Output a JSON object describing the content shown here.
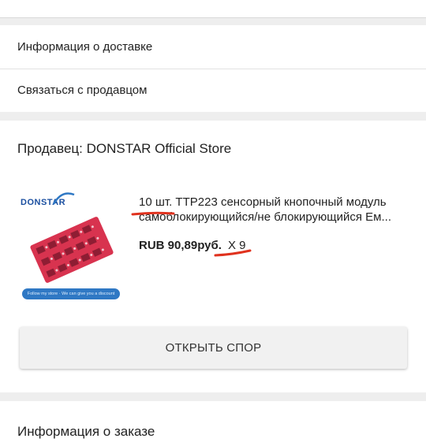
{
  "links": {
    "delivery_info": "Информация о доставке",
    "contact_seller": "Связаться с продавцом"
  },
  "seller": {
    "title": "Продавец: DONSTAR Official Store",
    "logo_text": "DONSTAR",
    "banner_text": "Follow my store  ·  We can give you a discount"
  },
  "product": {
    "name_line1": "10 шт. TTP223 сенсорный кнопочный модуль",
    "name_line2": "самоблокирующийся/не блокирующийся Ем...",
    "price": "RUB 90,89руб.",
    "quantity": "X 9"
  },
  "actions": {
    "open_dispute": "ОТКРЫТЬ СПОР"
  },
  "order": {
    "title": "Информация о заказе"
  },
  "colors": {
    "annotation_red": "#e0321e",
    "logo_blue": "#1b4fa0",
    "board_red": "#d8334f"
  }
}
